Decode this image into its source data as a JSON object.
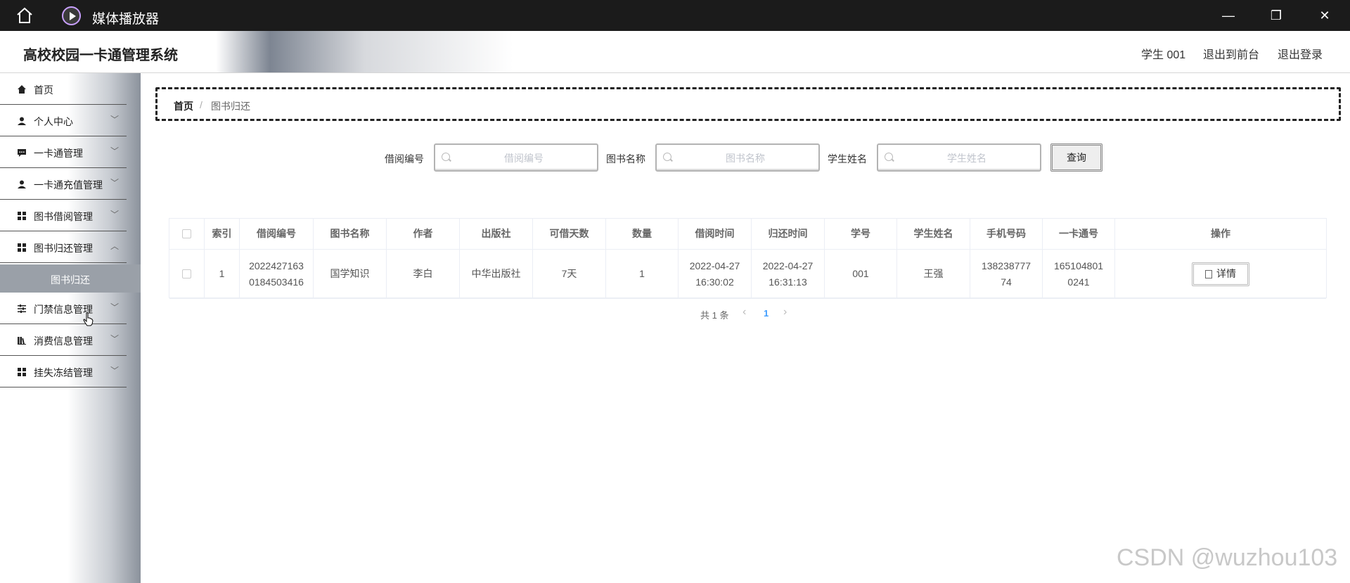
{
  "titlebar": {
    "app_title": "媒体播放器",
    "minimize": "—",
    "maximize": "❐",
    "close": "✕"
  },
  "header": {
    "system_title": "高校校园一卡通管理系统",
    "user": "学生 001",
    "back_front": "退出到前台",
    "logout": "退出登录"
  },
  "sidebar": {
    "items": [
      {
        "label": "首页",
        "icon": "home-icon",
        "has_chevron": false
      },
      {
        "label": "个人中心",
        "icon": "user-icon",
        "has_chevron": true
      },
      {
        "label": "一卡通管理",
        "icon": "chat-icon",
        "has_chevron": true
      },
      {
        "label": "一卡通充值管理",
        "icon": "user-icon",
        "has_chevron": true
      },
      {
        "label": "图书借阅管理",
        "icon": "grid-icon",
        "has_chevron": true
      },
      {
        "label": "图书归还管理",
        "icon": "grid-icon",
        "has_chevron": true
      },
      {
        "label": "门禁信息管理",
        "icon": "sliders-icon",
        "has_chevron": true
      },
      {
        "label": "消费信息管理",
        "icon": "bars-icon",
        "has_chevron": true
      },
      {
        "label": "挂失冻结管理",
        "icon": "grid-icon",
        "has_chevron": true
      }
    ],
    "active_sub": "图书归还"
  },
  "breadcrumb": {
    "home": "首页",
    "separator": "/",
    "current": "图书归还"
  },
  "filters": [
    {
      "label": "借阅编号",
      "placeholder": "借阅编号"
    },
    {
      "label": "图书名称",
      "placeholder": "图书名称"
    },
    {
      "label": "学生姓名",
      "placeholder": "学生姓名"
    }
  ],
  "query_button": "查询",
  "table": {
    "headers": [
      "索引",
      "借阅编号",
      "图书名称",
      "作者",
      "出版社",
      "可借天数",
      "数量",
      "借阅时间",
      "归还时间",
      "学号",
      "学生姓名",
      "手机号码",
      "一卡通号",
      "操作"
    ],
    "rows": [
      {
        "cells": [
          "1",
          "2022427163\n0184503416",
          "国学知识",
          "李白",
          "中华出版社",
          "7天",
          "1",
          "2022-04-27\n16:30:02",
          "2022-04-27\n16:31:13",
          "001",
          "王强",
          "138238777\n74",
          "165104801\n0241"
        ],
        "action": "详情"
      }
    ]
  },
  "pagination": {
    "total": "共 1 条",
    "prev": "‹",
    "page": "1",
    "next": "›"
  },
  "watermark": "CSDN @wuzhou103",
  "colors": {
    "page_active": "#409eff",
    "sidebar_active": "#9aa0a8",
    "titlebar": "#1b1b1b"
  }
}
